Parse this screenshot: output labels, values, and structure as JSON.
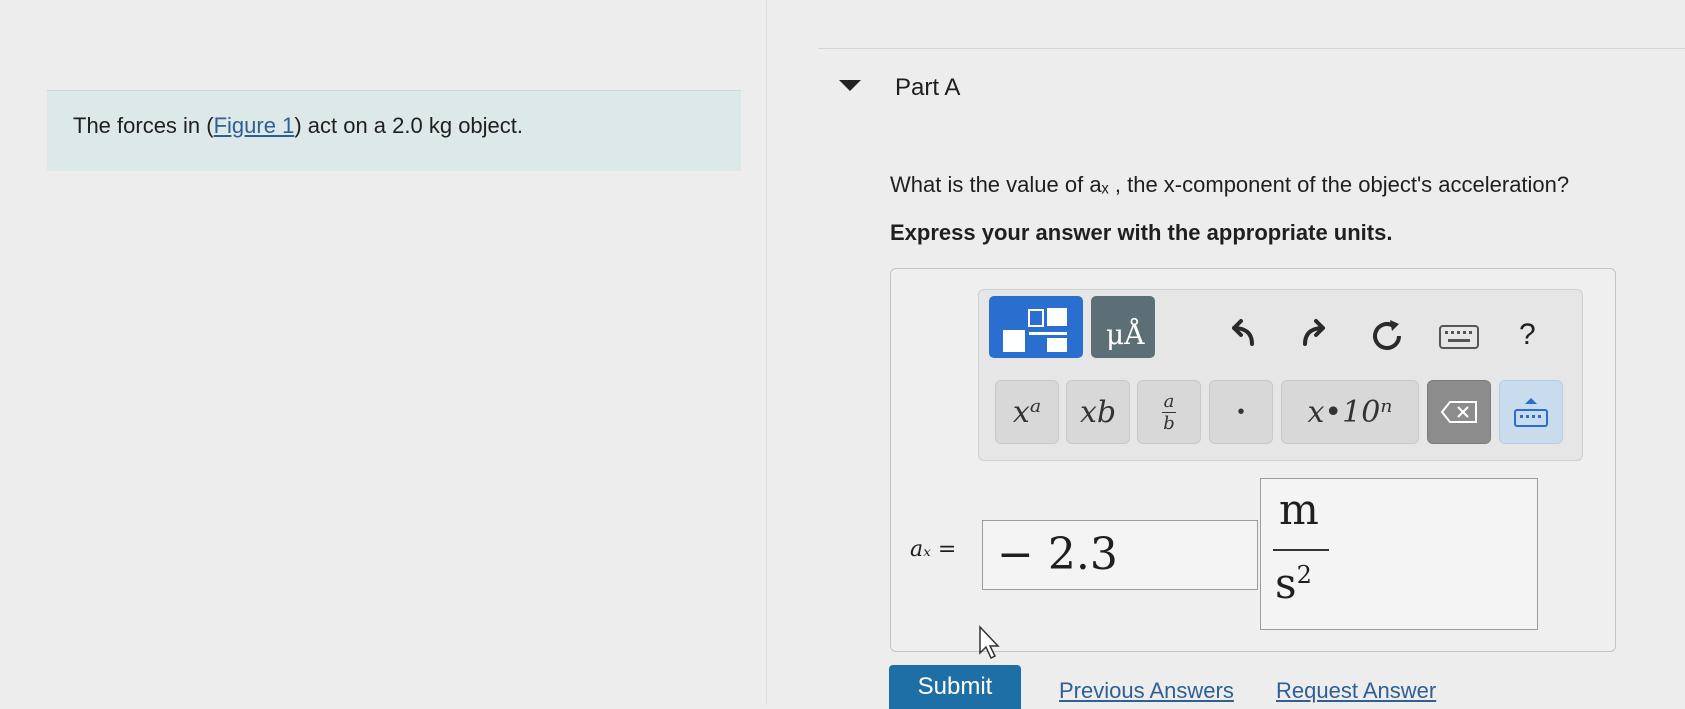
{
  "intro": {
    "prefix": "The forces in (",
    "figure_link": "Figure 1",
    "suffix": ") act on a 2.0 kg object."
  },
  "part": {
    "title": "Part A"
  },
  "question": "What is the value of aₓ , the x-component of the object's acceleration?",
  "instruction": "Express your answer with the appropriate units.",
  "toolbar": {
    "units_glyph": "μÅ",
    "help_label": "?",
    "keys": {
      "superscript": "xᵃ",
      "subscript": "xb",
      "fraction_num": "a",
      "fraction_den": "b",
      "dot": "•",
      "sci": "x•10ⁿ"
    }
  },
  "answer": {
    "label": "aₓ =",
    "value": "− 2.3",
    "unit_numerator": "m",
    "unit_denominator": "s",
    "unit_exponent": "2"
  },
  "actions": {
    "submit": "Submit",
    "previous": "Previous Answers",
    "request": "Request Answer"
  },
  "colors": {
    "accent": "#2a6fd0",
    "submit": "#1e6fa5",
    "link": "#2f5f93"
  }
}
